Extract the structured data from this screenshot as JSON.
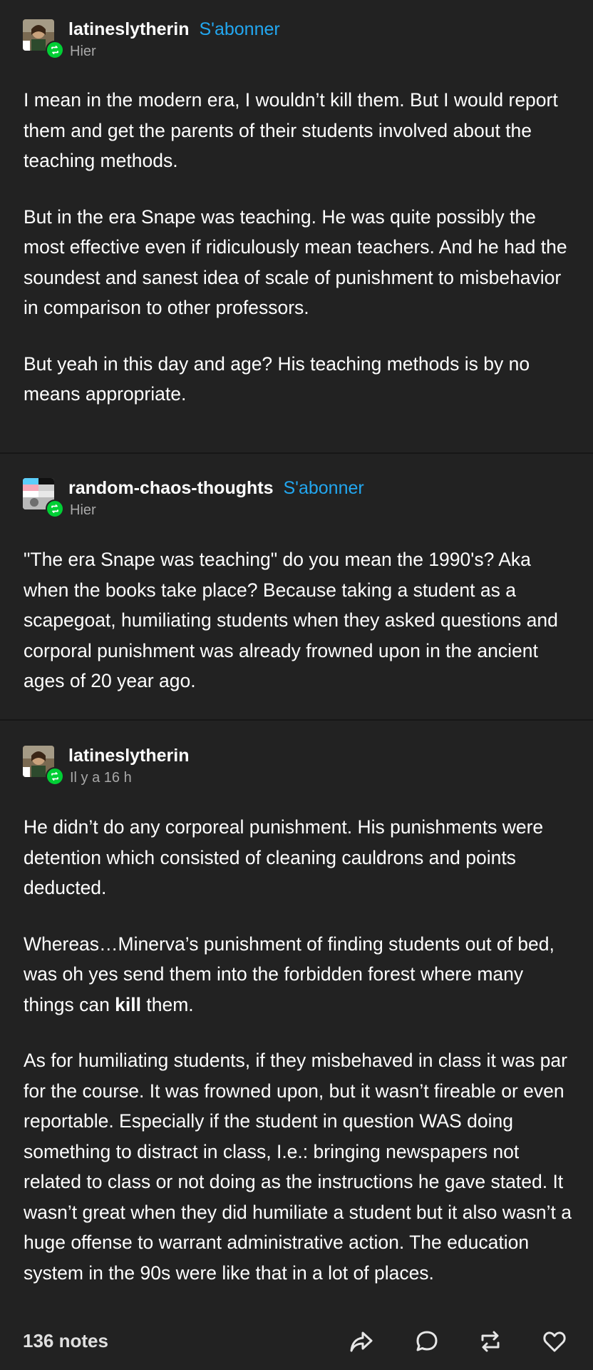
{
  "posts": [
    {
      "username": "latineslytherin",
      "follow_label": "S'abonner",
      "timestamp": "Hier",
      "paragraphs": [
        "I mean in the modern era, I wouldn’t kill them. But I would report them and get the parents of their students involved about the teaching methods.",
        "But in the era Snape was teaching. He was quite possibly the most effective even if ridiculously mean teachers. And he had the soundest and sanest idea of scale of punishment to misbehavior in comparison to other professors.",
        "But yeah in this day and age? His teaching methods is by no means appropriate."
      ]
    },
    {
      "username": "random-chaos-thoughts",
      "follow_label": "S'abonner",
      "timestamp": "Hier",
      "paragraphs": [
        "\"The era Snape was teaching\" do you mean the 1990's? Aka when the books take place? Because taking a student as a scapegoat, humiliating students when they asked questions and corporal punishment was already frowned upon in the ancient ages of 20 year ago."
      ]
    },
    {
      "username": "latineslytherin",
      "timestamp": "Il y a 16 h",
      "paragraphs": [
        "He didn’t do any corporeal punishment.  His punishments were detention which consisted of cleaning cauldrons and points deducted.",
        {
          "before": "Whereas…Minerva’s punishment of finding students out of bed, was oh yes send them into the forbidden forest where many things can ",
          "bold": "kill",
          "after": " them."
        },
        "As for humiliating students, if they misbehaved in class it was par for the course. It was frowned upon, but it wasn’t fireable or even reportable.  Especially if the student in question WAS doing something to distract in class, I.e.: bringing newspapers not related to class or not doing as the instructions he gave stated.  It wasn’t great when they did humiliate a student but it also wasn’t a huge offense to warrant administrative action.  The education system in the 90s were like that in a lot of places."
      ]
    }
  ],
  "footer": {
    "notes": "136 notes",
    "icons": [
      "share-icon",
      "reply-icon",
      "reblog-icon",
      "like-icon"
    ]
  },
  "colors": {
    "background": "#222222",
    "divider": "#171717",
    "follow": "#22a7f0",
    "reblog_badge": "#00cf35",
    "timestamp": "#a8a8a8"
  }
}
